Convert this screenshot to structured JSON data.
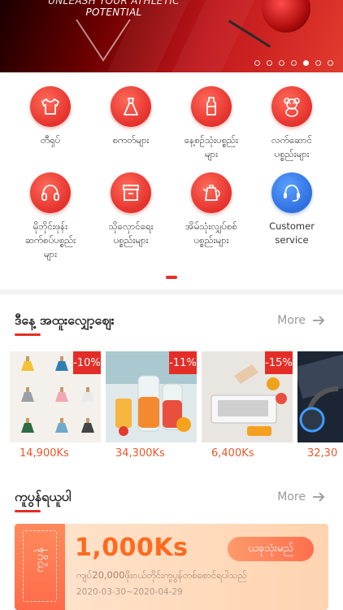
{
  "banner": {
    "line1": "UNLEASH YOUR ATHLETIC",
    "line2": "POTENTIAL",
    "dots": 7,
    "active_dot": 4
  },
  "categories": [
    {
      "label": "တီရှပ်",
      "icon": "tshirt-icon"
    },
    {
      "label": "စကတ်များ",
      "icon": "dress-icon"
    },
    {
      "label": "နေ့စဥ်သုံးပစ္စည်း\nများ",
      "icon": "bottle-icon"
    },
    {
      "label": "လက်ဆောင်\nပစ္စည်းများ",
      "icon": "teddy-bear-icon"
    },
    {
      "label": "မိုဘိုင်းဖုန်း\nဆက်စပ်ပစ္စည်း\nများ",
      "icon": "headphones-icon"
    },
    {
      "label": "သိုလှောင်ရေး\nပစ္စည်းများ",
      "icon": "storage-box-icon"
    },
    {
      "label": "အိမ်သုံးလျှပ်စစ်\nပစ္စည်းများ",
      "icon": "kettle-icon"
    },
    {
      "label": "Customer\nservice",
      "icon": "headset-icon"
    }
  ],
  "flash_sale": {
    "title": "ဒီနေ့ အထူးလျှော့ဈေး",
    "more_label": "More",
    "products": [
      {
        "price": "14,900Ks",
        "discount": "-10%"
      },
      {
        "price": "34,300Ks",
        "discount": "-11%"
      },
      {
        "price": "6,400Ks",
        "discount": "-15%"
      },
      {
        "price": "32,30",
        "discount": ""
      }
    ]
  },
  "coupons": {
    "title": "ကူပွန်ရယူပါ",
    "more_label": "More",
    "coupon": {
      "side_label": "ကူပွန်",
      "amount": "1,000Ks",
      "button": "ယခုသုံးမည်",
      "condition": "ကျပ်20,000ဖိုးဝယ်တိုင်းကူပွန်တစ်စောင်ရပါသည်",
      "dates": "2020-03-30~2020-04-29"
    }
  },
  "colors": {
    "accent": "#e52d27",
    "price": "#e8572d",
    "coupon_amount": "#ff6a1f"
  }
}
